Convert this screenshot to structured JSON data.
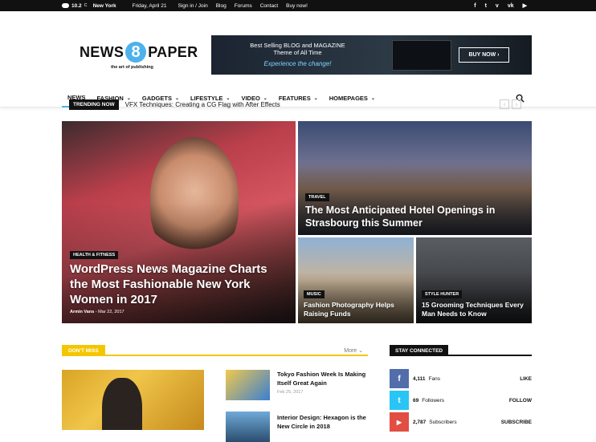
{
  "topbar": {
    "temp": "10.2",
    "temp_unit": "C",
    "city": "New York",
    "date": "Friday, April 21",
    "links": [
      "Sign in / Join",
      "Blog",
      "Forums",
      "Contact",
      "Buy now!"
    ],
    "socials": [
      "facebook-icon",
      "twitter-icon",
      "vimeo-icon",
      "vk-icon",
      "youtube-icon"
    ]
  },
  "logo": {
    "left": "NEWS",
    "mid": "8",
    "right": "PAPER",
    "tagline": "the art of publishing"
  },
  "banner": {
    "line1": "Best Selling BLOG and MAGAZINE",
    "line2": "Theme of All Time",
    "line3": "Experience the change!",
    "button": "BUY NOW ›"
  },
  "nav": {
    "items": [
      {
        "label": "NEWS",
        "chevron": ""
      },
      {
        "label": "FASHION",
        "chevron": "⌄"
      },
      {
        "label": "GADGETS",
        "chevron": "⌄"
      },
      {
        "label": "LIFESTYLE",
        "chevron": "⌄"
      },
      {
        "label": "VIDEO",
        "chevron": "⌄"
      },
      {
        "label": "FEATURES",
        "chevron": "⌄"
      },
      {
        "label": "HOMEPAGES",
        "chevron": "⌄"
      }
    ]
  },
  "trending": {
    "label": "TRENDING NOW",
    "headline": "VFX Techniques: Creating a CG Flag with After Effects",
    "prev": "‹",
    "next": "›"
  },
  "tiles": [
    {
      "category": "HEALTH & FITNESS",
      "title": "WordPress News Magazine Charts the Most Fashionable New York Women in 2017",
      "author": "Armin Vans",
      "date": "Mar 22, 2017"
    },
    {
      "category": "TRAVEL",
      "title": "The Most Anticipated Hotel Openings in Strasbourg this Summer"
    },
    {
      "category": "MUSIC",
      "title": "Fashion Photography Helps Raising Funds"
    },
    {
      "category": "STYLE HUNTER",
      "title": "15 Grooming Techniques Every Man Needs to Know"
    }
  ],
  "dontmiss": {
    "label": "DON'T MISS",
    "more": "More ⌄"
  },
  "small_posts": [
    {
      "title": "Tokyo Fashion Week Is Making Itself Great Again",
      "date": "Feb 25, 2017"
    },
    {
      "title": "Interior Design: Hexagon is the New Circle in 2018",
      "date": ""
    }
  ],
  "stay": {
    "label": "STAY CONNECTED",
    "rows": [
      {
        "glyph": "f",
        "count": "4,111",
        "unit": "Fans",
        "action": "LIKE",
        "color": "#516eab"
      },
      {
        "glyph": "t",
        "count": "69",
        "unit": "Followers",
        "action": "FOLLOW",
        "color": "#29c5f6"
      },
      {
        "glyph": "▶",
        "count": "2,787",
        "unit": "Subscribers",
        "action": "SUBSCRIBE",
        "color": "#e14e42"
      }
    ]
  }
}
